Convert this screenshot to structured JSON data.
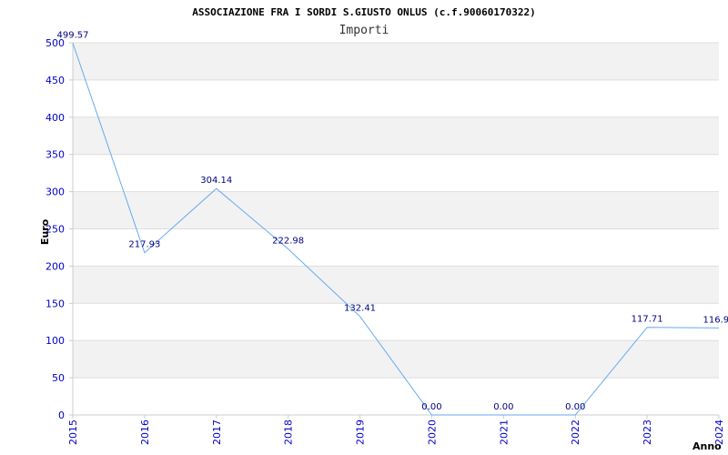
{
  "chart_data": {
    "type": "line",
    "title": "ASSOCIAZIONE FRA I SORDI S.GIUSTO ONLUS (c.f.90060170322)",
    "subtitle": "Importi",
    "xlabel": "Anno",
    "ylabel": "Euro",
    "ylim": [
      0,
      500
    ],
    "yticks": [
      "0",
      "50",
      "100",
      "150",
      "200",
      "250",
      "300",
      "350",
      "400",
      "450",
      "500"
    ],
    "categories": [
      "2015",
      "2016",
      "2017",
      "2018",
      "2019",
      "2020",
      "2021",
      "2022",
      "2023",
      "2024"
    ],
    "values": [
      499.57,
      217.93,
      304.14,
      222.98,
      132.41,
      0.0,
      0.0,
      0.0,
      117.71,
      116.9
    ],
    "value_labels": [
      "499.57",
      "217.93",
      "304.14",
      "222.98",
      "132.41",
      "0.00",
      "0.00",
      "0.00",
      "117.71",
      "116.90"
    ],
    "grid": true,
    "line_color": "#66aaee",
    "band_color": "#f2f2f2",
    "tick_color": "#0000cc",
    "label_color": "#000080"
  }
}
